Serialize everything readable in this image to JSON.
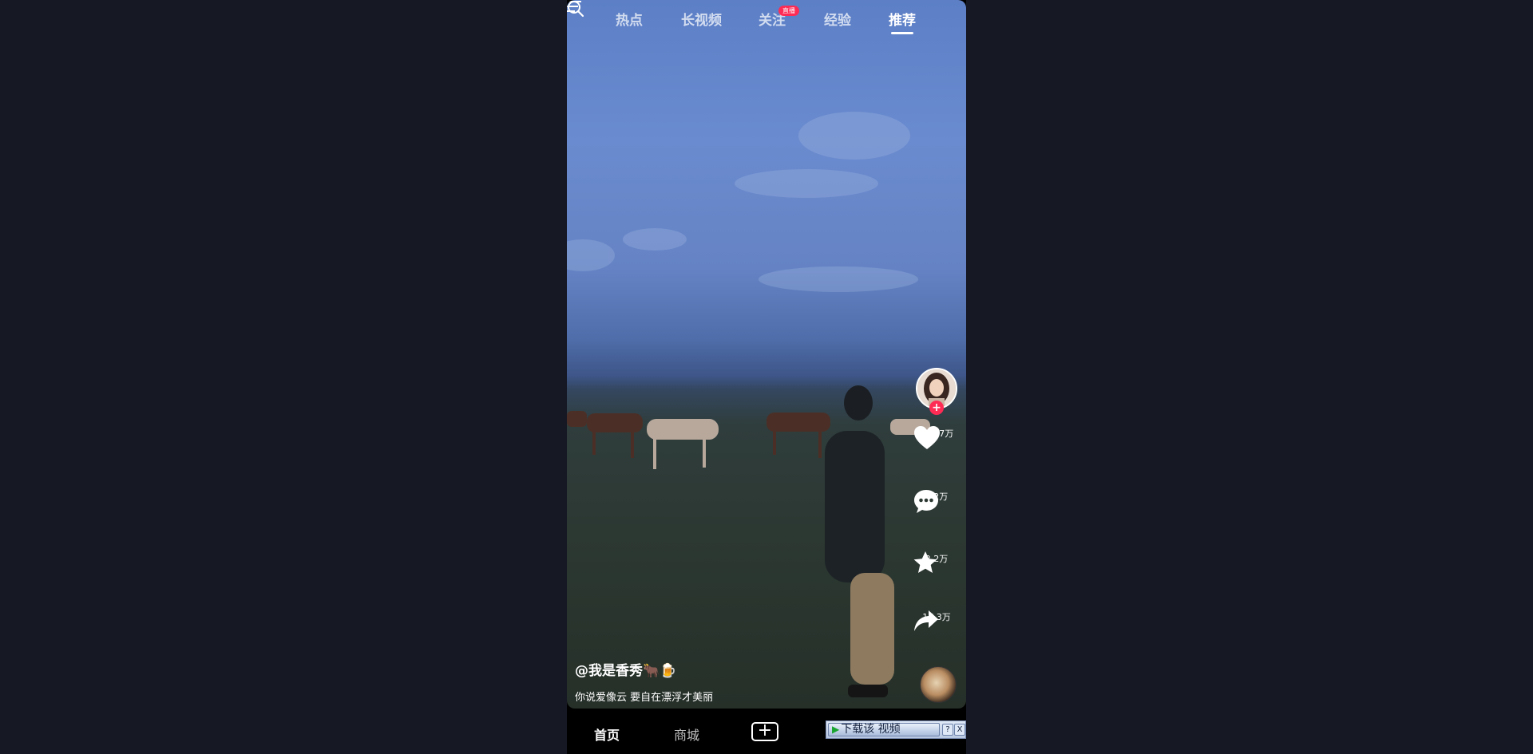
{
  "top_tabs": [
    {
      "label": "热点"
    },
    {
      "label": "长视频"
    },
    {
      "label": "关注"
    },
    {
      "label": "经验"
    },
    {
      "label": "推荐"
    }
  ],
  "live_badge": "直播",
  "active_tab": "推荐",
  "actions": {
    "likes": "124.7万",
    "comments": "2.2万",
    "favorites": "2.2万",
    "shares": "17.3万"
  },
  "video": {
    "author": "@我是香秀🐂🍺",
    "description": "你说爱像云 要自在漂浮才美丽"
  },
  "bottom_nav": {
    "home": "首页",
    "mall": "商城",
    "add": "+"
  },
  "download_bar": {
    "label": "下载该 视频",
    "help": "?",
    "close": "X"
  },
  "colors": {
    "accent": "#fe2c55",
    "background": "#161824"
  }
}
